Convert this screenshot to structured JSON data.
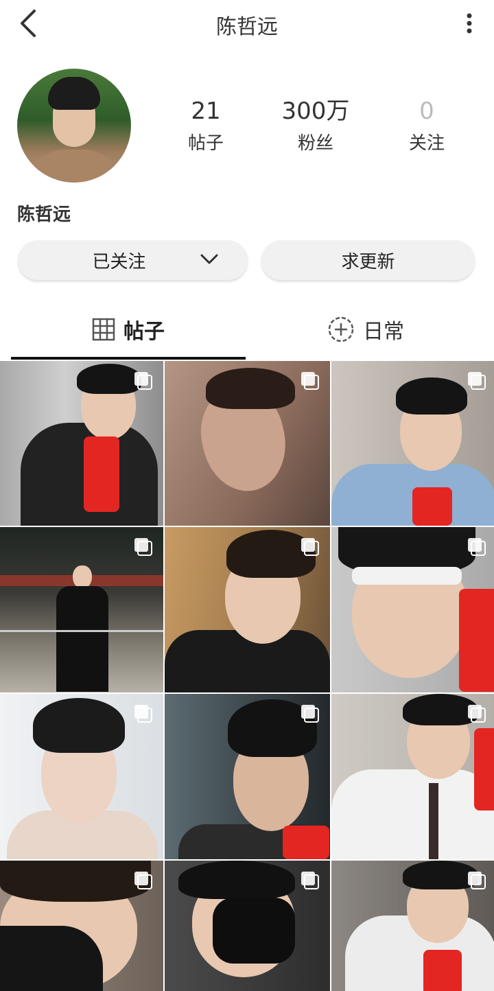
{
  "header": {
    "title": "陈哲远"
  },
  "profile": {
    "stats": [
      {
        "value": "21",
        "label": "帖子"
      },
      {
        "value": "300万",
        "label": "粉丝"
      },
      {
        "value": "0",
        "label": "关注"
      }
    ],
    "name": "陈哲远"
  },
  "actions": {
    "follow_label": "已关注",
    "request_label": "求更新"
  },
  "tabs": [
    {
      "label": "帖子",
      "icon": "grid-icon",
      "active": true
    },
    {
      "label": "日常",
      "icon": "plus-circle-icon",
      "active": false
    }
  ],
  "grid": {
    "post_count_visible": 12,
    "multi_image_icon": "multi-image-icon"
  },
  "colors": {
    "background": "#ffffff",
    "pill": "#f1f1f1",
    "accent_red_phone": "#e32622"
  }
}
